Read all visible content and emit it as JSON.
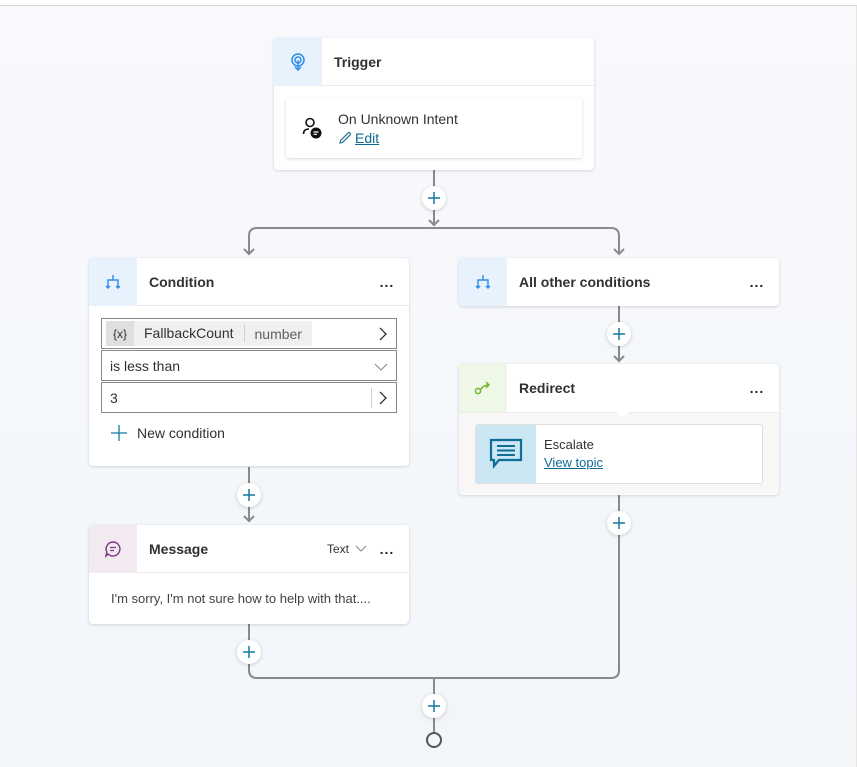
{
  "canvas": {
    "trigger": {
      "title": "Trigger",
      "icon": "trigger-icon",
      "event_name": "On Unknown Intent",
      "event_icon": "person-chat-icon",
      "edit_label": "Edit"
    },
    "add_step_label": "+",
    "condition": {
      "title": "Condition",
      "icon": "branch-icon",
      "more_label": "...",
      "variable_badge": "{x}",
      "variable_name": "FallbackCount",
      "variable_type": "number",
      "operator": "is less than",
      "value": "3",
      "new_condition_label": "New condition"
    },
    "other_conditions": {
      "title": "All other conditions",
      "icon": "branch-icon",
      "more_label": "..."
    },
    "redirect": {
      "title": "Redirect",
      "icon": "redirect-icon",
      "more_label": "...",
      "topic_name": "Escalate",
      "topic_icon": "chat-message-icon",
      "view_topic_label": "View topic"
    },
    "message": {
      "title": "Message",
      "icon": "chat-bubble-icon",
      "type_label": "Text",
      "more_label": "...",
      "text": "I'm sorry, I'm not sure how to help with that...."
    }
  },
  "colors": {
    "accent_blue": "#0f6cbd",
    "link": "#106a94",
    "plus_icon": "#117ba0",
    "connector": "#8a8a8a",
    "trigger_icon_bg": "#e8f2fd",
    "redirect_icon_bg": "#eff7e6",
    "message_icon_bg": "#f2e9f1",
    "topic_icon_bg": "#cae7f3"
  }
}
